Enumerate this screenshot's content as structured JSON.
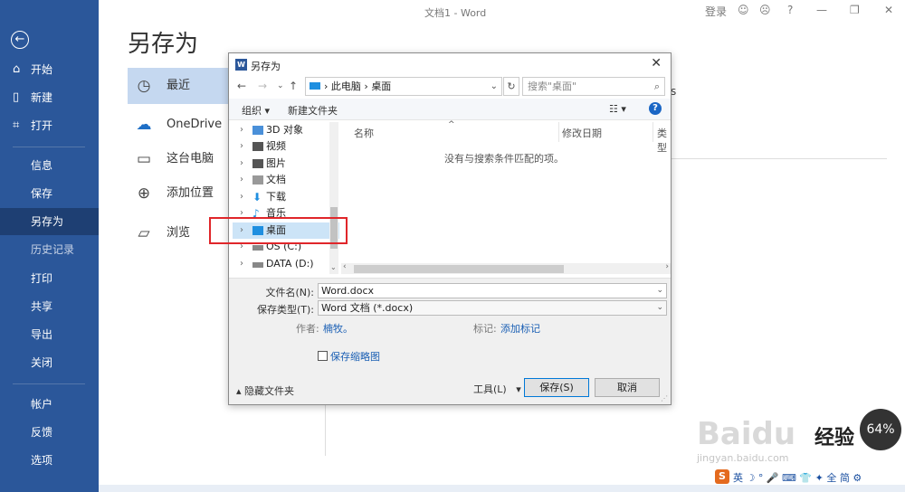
{
  "window": {
    "title": "文档1 - Word",
    "login": "登录",
    "help": "?"
  },
  "rail": {
    "back_icon": "←",
    "items": [
      {
        "label": "开始",
        "icon": "⌂"
      },
      {
        "label": "新建",
        "icon": "▯"
      },
      {
        "label": "打开",
        "icon": "⌗"
      },
      {
        "label": "信息"
      },
      {
        "label": "保存"
      },
      {
        "label": "另存为"
      },
      {
        "label": "历史记录"
      },
      {
        "label": "打印"
      },
      {
        "label": "共享"
      },
      {
        "label": "导出"
      },
      {
        "label": "关闭"
      },
      {
        "label": "帐户"
      },
      {
        "label": "反馈"
      },
      {
        "label": "选项"
      }
    ]
  },
  "backstage": {
    "title": "另存为",
    "locations": [
      {
        "label": "最近",
        "icon": "◷"
      },
      {
        "label": "OneDrive",
        "icon": "☁"
      },
      {
        "label": "这台电脑",
        "icon": "▭"
      },
      {
        "label": "添加位置",
        "icon": "⊕"
      },
      {
        "label": "浏览",
        "icon": "▱"
      }
    ],
    "fragment": "s"
  },
  "dialog": {
    "title": "另存为",
    "close": "✕",
    "path": [
      "此电脑",
      "桌面"
    ],
    "search_placeholder": "搜索\"桌面\"",
    "cmd_organize": "组织 ▾",
    "cmd_newfolder": "新建文件夹",
    "view_icon": "☷ ▾",
    "tree": [
      {
        "label": "3D 对象",
        "color": "#4a90d9"
      },
      {
        "label": "视频",
        "color": "#555"
      },
      {
        "label": "图片",
        "color": "#555"
      },
      {
        "label": "文档",
        "color": "#888"
      },
      {
        "label": "下载",
        "color": "#1f8fe0"
      },
      {
        "label": "音乐",
        "color": "#1f8fe0"
      },
      {
        "label": "桌面",
        "color": "#1f8fe0"
      },
      {
        "label": "OS (C:)",
        "color": "#777"
      },
      {
        "label": "DATA (D:)",
        "color": "#777"
      }
    ],
    "columns": [
      "名称",
      "修改日期",
      "类型"
    ],
    "empty_message": "没有与搜索条件匹配的项。",
    "filename_label": "文件名(N):",
    "filename_value": "Word.docx",
    "filetype_label": "保存类型(T):",
    "filetype_value": "Word 文档 (*.docx)",
    "author_label": "作者:",
    "author_value": "楠牧。",
    "tags_label": "标记:",
    "tags_value": "添加标记",
    "thumbnail_label": "保存缩略图",
    "hide_folders": "隐藏文件夹",
    "tools": "工具(L)",
    "save": "保存(S)",
    "cancel": "取消"
  },
  "overlay": {
    "watermark": "Baidu",
    "watermark_sub": "jingyan.baidu.com",
    "jingyan": "经验",
    "badge": "64%",
    "ime_logo": "S",
    "ime_text": "英 ☽ ° 🎤 ⌨ 👕 ✦ 全 简 ⚙"
  }
}
